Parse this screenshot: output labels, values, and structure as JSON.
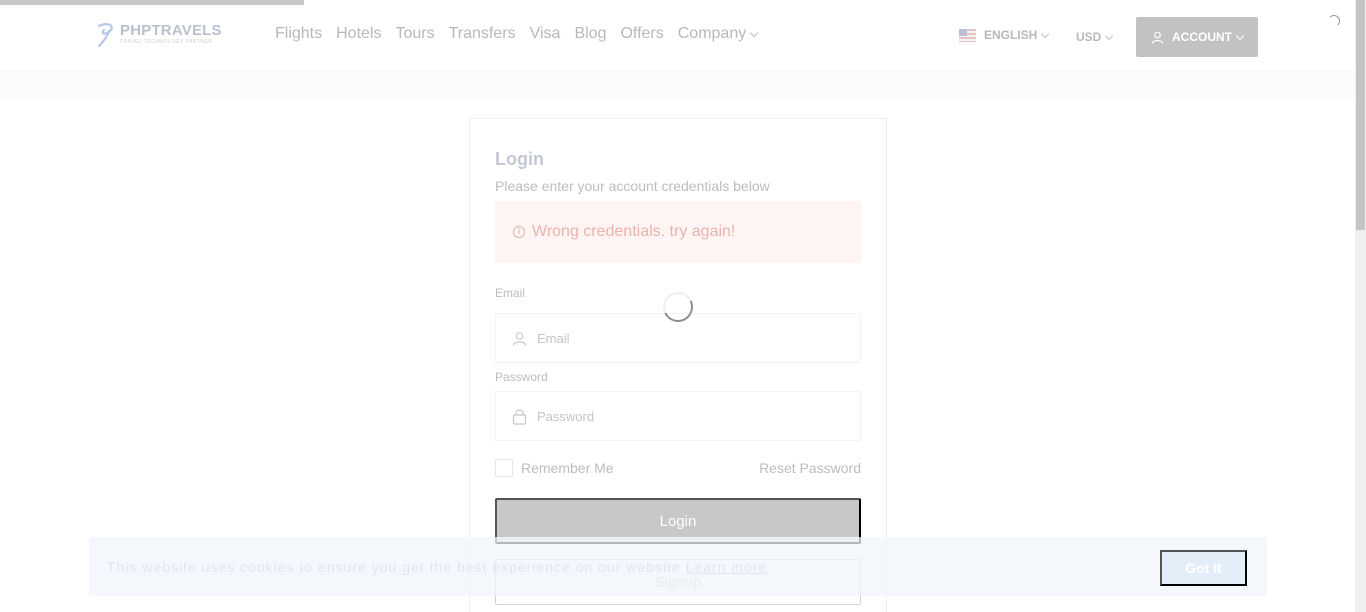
{
  "header": {
    "brand": "PHPTRAVELS",
    "tagline": "TRAVEL TECHNOLOGY PARTNER",
    "nav": [
      {
        "label": "Flights"
      },
      {
        "label": "Hotels"
      },
      {
        "label": "Tours"
      },
      {
        "label": "Transfers"
      },
      {
        "label": "Visa"
      },
      {
        "label": "Blog"
      },
      {
        "label": "Offers"
      },
      {
        "label": "Company"
      }
    ],
    "language": "ENGLISH",
    "currency": "USD",
    "account_label": "ACCOUNT"
  },
  "login": {
    "title": "Login",
    "subtitle": "Please enter your account credentials below",
    "alert": "Wrong credentials. try again!",
    "email_label": "Email",
    "email_placeholder": "Email",
    "email_value": "",
    "password_label": "Password",
    "password_placeholder": "Password",
    "password_value": "",
    "remember_label": "Remember Me",
    "remember_checked": false,
    "reset_label": "Reset Password",
    "login_button": "Login",
    "signup_button": "Signup"
  },
  "cookie": {
    "text": "This website uses cookies to ensure you get the best experience on our website",
    "link": "Learn more",
    "button": "Got It"
  },
  "icons": {
    "logo": "phptravels-logo-icon",
    "flag": "us-flag-icon",
    "account": "user-icon",
    "alert": "info-icon",
    "email": "user-icon",
    "password": "lock-icon",
    "loading": "spinner-icon"
  }
}
